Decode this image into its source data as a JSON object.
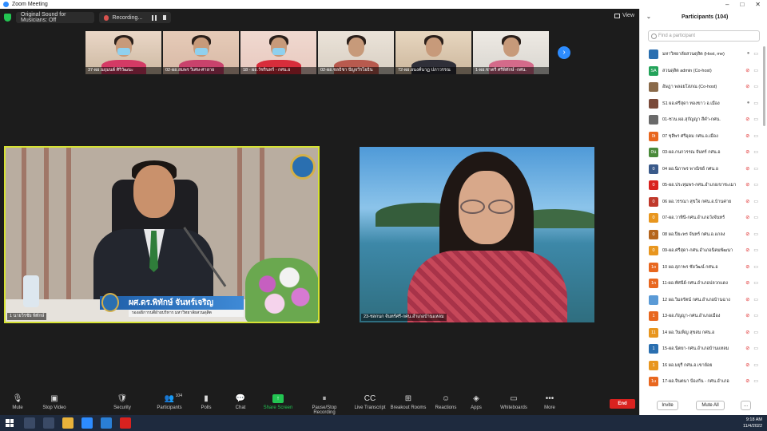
{
  "window": {
    "title": "Zoom Meeting",
    "controls": [
      "–",
      "□",
      "✕"
    ]
  },
  "topbar": {
    "sound_label": "Original Sound for Musicians: Off",
    "recording_label": "Recording...",
    "view_label": "View"
  },
  "thumbnails": [
    {
      "name": "37-ผอ.นฤมนต์ ศิริวัฒนะ",
      "bg": "#cdb9a2",
      "top": "#ead7c7",
      "body": "#d43a65",
      "mask": true
    },
    {
      "name": "02-ผอ.สมพร วิเศษ-ศาลาย",
      "bg": "#d8b9a6",
      "top": "#e6cbb8",
      "body": "#c9426c",
      "mask": true
    },
    {
      "name": "18 - ผอ.วัชรินทร์ - กศน.อ",
      "bg": "#e8c9bf",
      "top": "#f0d9d0",
      "body": "#d82d3b",
      "mask": true
    },
    {
      "name": "02-ผอ.ชลธิชา ปัญจวีรโยธิน",
      "bg": "#d8cfc3",
      "top": "#ebe3d9",
      "body": "#b85a4e",
      "mask": false
    },
    {
      "name": "72-ผอ.อนงค์นาฏ ปภาวรรณ",
      "bg": "#cdb89e",
      "top": "#e7d6bf",
      "body": "#2f2f38",
      "mask": false
    },
    {
      "name": "1-ผอ.ชาตรี ศรีพิทักษ์ -กศน.",
      "bg": "#d9d6d0",
      "top": "#eeeae4",
      "body": "#d46a8a",
      "mask": false
    }
  ],
  "speaker_left": {
    "label": "1 นายวิรชัย พิทักษ์",
    "name_main": "ผศ.ดร.พิทักษ์ จันทร์เจริญ",
    "name_sub": "รองอธิการบดีฝ่ายบริหาร มหาวิทยาลัยสวนดุสิต"
  },
  "speaker_right": {
    "label": "23-ชลกนก จันทร์ศรี-กศน.อำเภอบ้านแหลม"
  },
  "participants_panel": {
    "title": "Participants (104)",
    "search_placeholder": "Find a participant",
    "invite_label": "Invite",
    "mute_all_label": "Mute All",
    "more_label": "..."
  },
  "participants": [
    {
      "initials": "",
      "color": "#2a6fb0",
      "name": "มหาวิทยาลัยสวนดุสิต (Host, me)",
      "muted": false
    },
    {
      "initials": "SA",
      "color": "#23a35a",
      "name": "สวนดุสิต admin (Co-host)",
      "muted": true
    },
    {
      "initials": "",
      "color": "#8a6a4a",
      "name": "อัษฎา พลอยโสภณ (Co-host)",
      "muted": true
    },
    {
      "initials": "",
      "color": "#7a4a3a",
      "name": "S1 ผอ.ศรีสุดา ทองขาว อ.เมือง",
      "muted": false
    },
    {
      "initials": "",
      "color": "#6a6a6a",
      "name": "01-ชวน ผอ.สุกัญญา สีคำ-กศน.",
      "muted": true
    },
    {
      "initials": "0t",
      "color": "#e8671f",
      "name": "07 ชุลีพร ศรีอุดม กศน.อ.เมือง",
      "muted": true
    },
    {
      "initials": "0น",
      "color": "#4a8a3a",
      "name": "03-ผอ.กนกวรรณ จันทร์ กศน.อ",
      "muted": true
    },
    {
      "initials": "0",
      "color": "#3a5a8a",
      "name": "04 ผอ.นิภาพร พาณิชย์ กศน.อ",
      "muted": true
    },
    {
      "initials": "0",
      "color": "#d9221f",
      "name": "05-ผอ.ประทุมพร-กศน.อำเภอเขาชะเมา",
      "muted": true
    },
    {
      "initials": "0",
      "color": "#c0392b",
      "name": "06 ผอ.วรรณา สุขใจ กศน.อ.บ้านค่าย",
      "muted": true
    },
    {
      "initials": "0",
      "color": "#e8961f",
      "name": "07-ผอ.วาทินี-กศน.อำเภอวังจันทร์",
      "muted": true
    },
    {
      "initials": "0",
      "color": "#b5651d",
      "name": "08 ผอ.ปิยะพร จันทร์ กศน.อ.แกลง",
      "muted": true
    },
    {
      "initials": "0",
      "color": "#e8961f",
      "name": "09-ผอ.ศรีสุดา-กศน.อำเภอนิคมพัฒนา",
      "muted": true
    },
    {
      "initials": "1o",
      "color": "#e8671f",
      "name": "10 ผอ.สุภาพร ชัยวัฒน์ กศน.อ",
      "muted": true
    },
    {
      "initials": "1n",
      "color": "#e8671f",
      "name": "11-ผอ.ทัศนีย์-กศน.อำเภอปลวกแดง",
      "muted": true
    },
    {
      "initials": "",
      "color": "#5a9ad6",
      "name": "12 ผอ.วิมลรัตน์ กศน.อำเภอบ้านฉาง",
      "muted": true
    },
    {
      "initials": "1",
      "color": "#e8671f",
      "name": "13-ผอ.กัญญา-กศน.อำเภอเมือง",
      "muted": true
    },
    {
      "initials": "11",
      "color": "#e8961f",
      "name": "14 ผอ.วันเพ็ญ สุขสม กศน.อ",
      "muted": true
    },
    {
      "initials": "1",
      "color": "#2a6fb0",
      "name": "15-ผอ.นิตยา-กศน.อำเภอบ้านแหลม",
      "muted": true
    },
    {
      "initials": "1",
      "color": "#e8961f",
      "name": "16 ผอ.มยุรี กศน.อ.เขาย้อย",
      "muted": true
    },
    {
      "initials": "1u",
      "color": "#e8671f",
      "name": "17-ผอ.จินตนา ป้องกัน - กศน.อำเภอ",
      "muted": true
    }
  ],
  "toolbar": [
    {
      "name": "mute",
      "label": "Mute",
      "icon": "🎙"
    },
    {
      "name": "stop-video",
      "label": "Stop Video",
      "icon": "▣"
    },
    {
      "name": "security",
      "label": "Security",
      "icon": "🛡"
    },
    {
      "name": "participants",
      "label": "Participants",
      "icon": "👥",
      "count": "104"
    },
    {
      "name": "polls",
      "label": "Polls",
      "icon": "▮"
    },
    {
      "name": "chat",
      "label": "Chat",
      "icon": "💬"
    },
    {
      "name": "share-screen",
      "label": "Share Screen",
      "icon": "↑"
    },
    {
      "name": "pause-stop-recording",
      "label": "Pause/Stop Recording",
      "icon": "⏸"
    },
    {
      "name": "live-transcript",
      "label": "Live Transcript",
      "icon": "CC"
    },
    {
      "name": "breakout-rooms",
      "label": "Breakout Rooms",
      "icon": "⊞"
    },
    {
      "name": "reactions",
      "label": "Reactions",
      "icon": "☺"
    },
    {
      "name": "apps",
      "label": "Apps",
      "icon": "◈"
    },
    {
      "name": "whiteboards",
      "label": "Whiteboards",
      "icon": "▭"
    },
    {
      "name": "more",
      "label": "More",
      "icon": "•••"
    }
  ],
  "end_label": "End",
  "clock": {
    "time": "9:18 AM",
    "date": "11/4/2022"
  },
  "colors": {
    "accent": "#2d8cff",
    "share": "#23c552",
    "end": "#d9221f",
    "speaker_border": "#d6e233"
  }
}
